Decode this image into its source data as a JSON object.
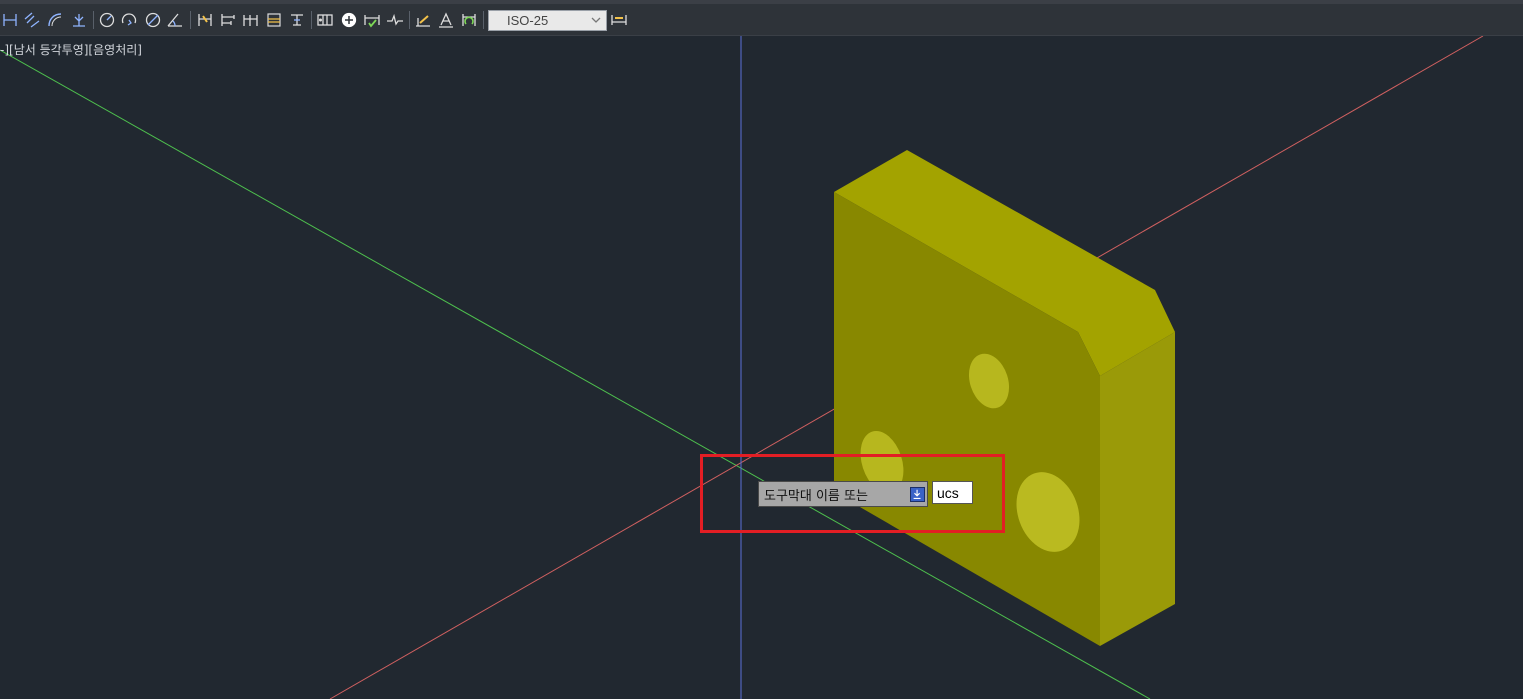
{
  "toolbar": {
    "dim_style": "ISO-25",
    "tools": [
      "linear-dimension-icon",
      "aligned-dimension-icon",
      "arc-length-icon",
      "ordinate-dimension-icon",
      "radius-dimension-icon",
      "jogged-dimension-icon",
      "diameter-dimension-icon",
      "angular-dimension-icon",
      "quick-dimension-icon",
      "baseline-dimension-icon",
      "continue-dimension-icon",
      "dimension-space-icon",
      "dimension-break-icon",
      "tolerance-icon",
      "center-mark-icon",
      "inspection-icon",
      "jogged-linear-icon",
      "dimension-edit-icon",
      "dimension-text-edit-icon",
      "dimension-update-icon",
      "dimension-style-icon"
    ]
  },
  "viewport": {
    "view_label": "-][남서 등각투영][음영처리]"
  },
  "command": {
    "prompt": "도구막대 이름 또는",
    "input_value": "ucs"
  },
  "colors": {
    "background": "#212830",
    "solid": "#a3a300",
    "highlight": "#e31e24",
    "x_axis": "#d06060",
    "y_axis": "#4ec04e",
    "z_axis": "#5a6fd8"
  }
}
